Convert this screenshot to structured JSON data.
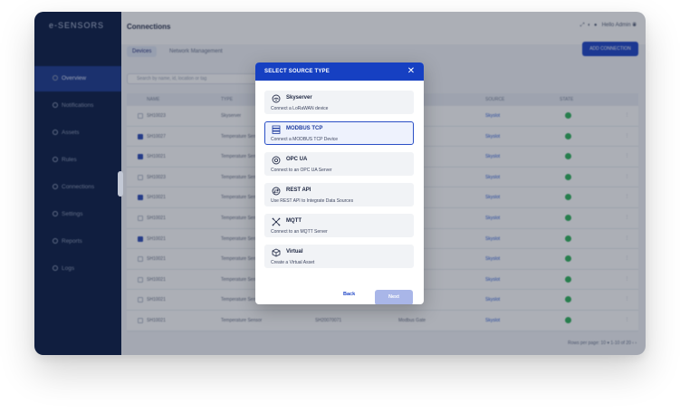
{
  "app": {
    "brand": "e-SENSORS",
    "page_title": "Connections",
    "top_user": "Hello Admin",
    "tabs": [
      {
        "label": "Devices",
        "active": true
      },
      {
        "label": "Network Management",
        "active": false
      }
    ],
    "add_button": "ADD CONNECTION",
    "search_placeholder": "Search by name, id, location or tag",
    "sidebar": [
      {
        "label": "Overview",
        "active": true
      },
      {
        "label": "Notifications",
        "active": false
      },
      {
        "label": "Assets",
        "active": false
      },
      {
        "label": "Rules",
        "active": false
      },
      {
        "label": "Connections",
        "active": false
      },
      {
        "label": "Settings",
        "active": false
      },
      {
        "label": "Reports",
        "active": false
      },
      {
        "label": "Logs",
        "active": false
      }
    ],
    "table_headers": [
      "NAME",
      "TYPE",
      "",
      "",
      "SOURCE",
      "STATE",
      ""
    ],
    "rows": [
      {
        "checked": false,
        "name": "SH10023",
        "type": "Skyserver",
        "col3": "",
        "col4": "",
        "link": "Skyslot"
      },
      {
        "checked": true,
        "name": "SH10027",
        "type": "Temperature Sensor",
        "col3": "",
        "col4": "",
        "link": "Skyslot"
      },
      {
        "checked": true,
        "name": "SH10021",
        "type": "Temperature Sensor",
        "col3": "",
        "col4": "",
        "link": "Skyslot"
      },
      {
        "checked": false,
        "name": "SH10023",
        "type": "Temperature Sensor",
        "col3": "",
        "col4": "",
        "link": "Skyslot"
      },
      {
        "checked": true,
        "name": "SH10021",
        "type": "Temperature Sensor",
        "col3": "",
        "col4": "",
        "link": "Skyslot"
      },
      {
        "checked": false,
        "name": "SH10021",
        "type": "Temperature Sensor",
        "col3": "",
        "col4": "",
        "link": "Skyslot"
      },
      {
        "checked": true,
        "name": "SH10021",
        "type": "Temperature Sensor",
        "col3": "",
        "col4": "",
        "link": "Skyslot"
      },
      {
        "checked": false,
        "name": "SH10021",
        "type": "Temperature Sensor",
        "col3": "",
        "col4": "",
        "link": "Skyslot"
      },
      {
        "checked": false,
        "name": "SH10021",
        "type": "Temperature Sensor",
        "col3": "",
        "col4": "",
        "link": "Skyslot"
      },
      {
        "checked": false,
        "name": "SH10021",
        "type": "Temperature Sensor",
        "col3": "",
        "col4": "",
        "link": "Skyslot"
      },
      {
        "checked": false,
        "name": "SH10021",
        "type": "Temperature Sensor",
        "col3": "SH20070071",
        "col4": "Modbus Gate",
        "link": "Skyslot"
      }
    ],
    "pager": "Rows per page: 10  ▾     1-10 of 20     ‹   ›"
  },
  "modal": {
    "title": "SELECT SOURCE TYPE",
    "close_icon": "close-icon",
    "options": [
      {
        "title": "Skyserver",
        "desc": "Connect a LoRaWAN device",
        "icon": "skyserver-icon",
        "selected": false
      },
      {
        "title": "MODBUS TCP",
        "desc": "Connect a MODBUS TCP Device",
        "icon": "modbus-icon",
        "selected": true
      },
      {
        "title": "OPC UA",
        "desc": "Connect to an OPC UA Server",
        "icon": "opc-ua-icon",
        "selected": false
      },
      {
        "title": "REST API",
        "desc": "Use REST API to Integrate Data Sources",
        "icon": "rest-api-icon",
        "selected": false
      },
      {
        "title": "MQTT",
        "desc": "Connect to an MQTT Server",
        "icon": "mqtt-icon",
        "selected": false
      },
      {
        "title": "Virtual",
        "desc": "Create a Virtual Asset",
        "icon": "virtual-icon",
        "selected": false
      }
    ],
    "back_label": "Back",
    "next_label": "Next"
  },
  "colors": {
    "primary": "#1640c2",
    "sidebar": "#0b1d45",
    "status_ok": "#2fb35b",
    "next_disabled": "#a9b6e8"
  }
}
